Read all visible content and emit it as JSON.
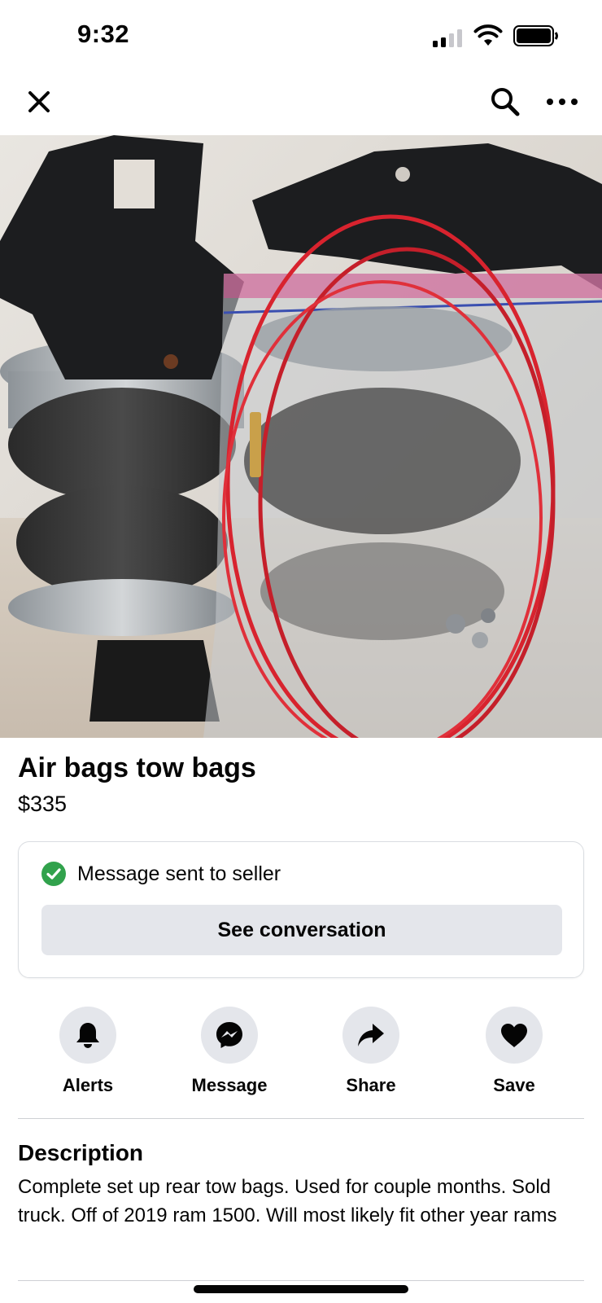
{
  "status_bar": {
    "time": "9:32"
  },
  "nav": {
    "close_icon": "close-icon",
    "search_icon": "search-icon",
    "more_icon": "more-options-icon"
  },
  "listing": {
    "title": "Air bags tow bags",
    "price": "$335",
    "photo_subject": "photo"
  },
  "message_card": {
    "status_text": "Message sent to seller",
    "button_label": "See conversation",
    "status_color": "#31a24c"
  },
  "actions": [
    {
      "label": "Alerts",
      "icon": "bell-icon"
    },
    {
      "label": "Message",
      "icon": "messenger-icon"
    },
    {
      "label": "Share",
      "icon": "share-arrow-icon"
    },
    {
      "label": "Save",
      "icon": "heart-icon"
    }
  ],
  "description": {
    "heading": "Description",
    "body": "Complete set up rear tow bags. Used for couple months. Sold truck. Off of 2019 ram 1500. Will most likely fit other year rams"
  },
  "colors": {
    "button_gray": "#e4e6eb",
    "text": "#050505",
    "divider": "#ced0d4"
  }
}
